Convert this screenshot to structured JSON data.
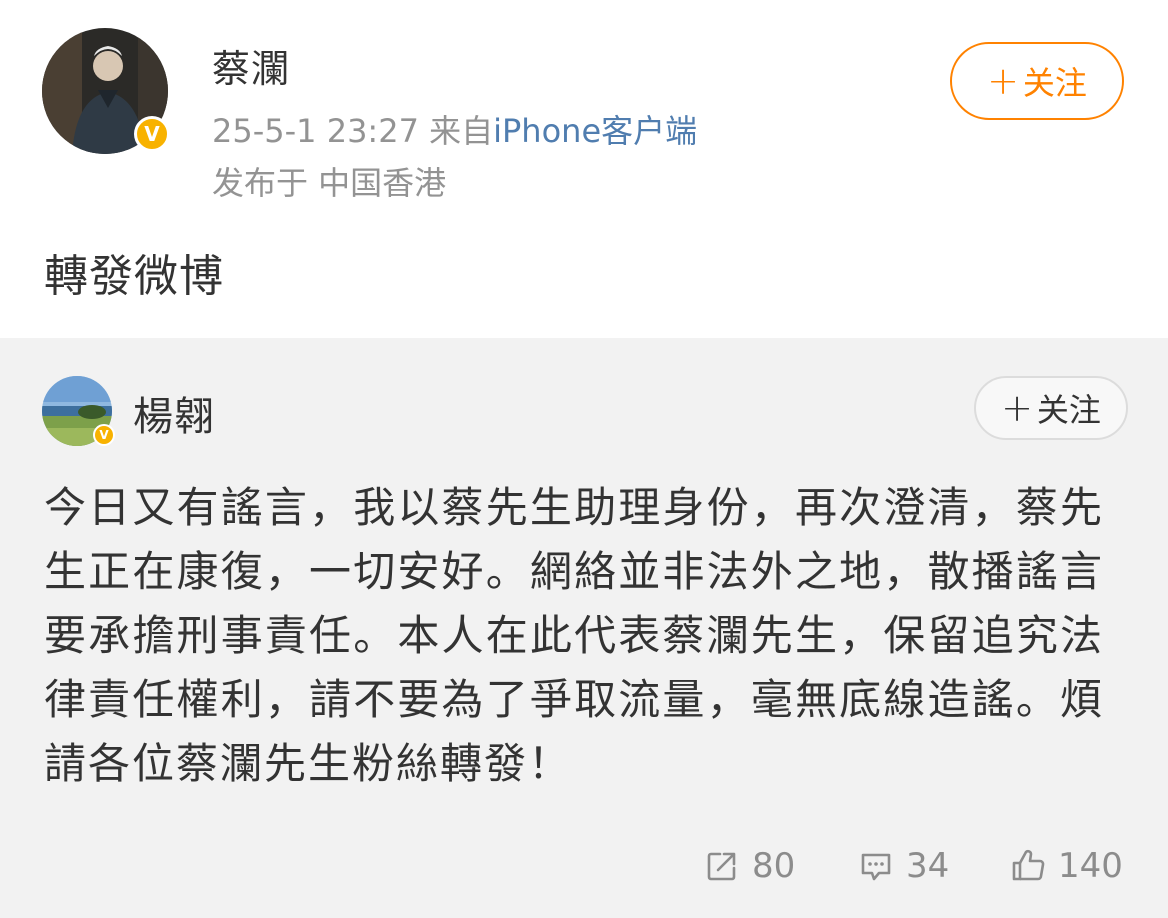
{
  "post": {
    "author": "蔡瀾",
    "timestamp": "25-5-1 23:27",
    "from_prefix": "来自",
    "source": "iPhone客户端",
    "location": "发布于 中国香港",
    "follow_plus": "+",
    "follow_label": "关注",
    "text": "轉發微博",
    "verified_badge": "V"
  },
  "repost": {
    "author": "楊翱",
    "follow_plus": "+",
    "follow_label": "关注",
    "verified_badge": "V",
    "text": "今日又有謠言，我以蔡先生助理身份，再次澄清，蔡先生正在康復，一切安好。網絡並非法外之地，散播謠言要承擔刑事責任。本人在此代表蔡瀾先生，保留追究法律責任權利，請不要為了爭取流量，毫無底線造謠。煩請各位蔡瀾先生粉絲轉發！",
    "stats": {
      "reposts": "80",
      "comments": "34",
      "likes": "140"
    }
  },
  "icons": {
    "repost": "share-arrow-icon",
    "comment": "comment-bubble-icon",
    "like": "thumbs-up-icon"
  },
  "colors": {
    "accent": "#ff8200",
    "link": "#507daf",
    "verified": "#f8b200",
    "muted": "#939393",
    "repost_bg": "#f2f2f2"
  }
}
